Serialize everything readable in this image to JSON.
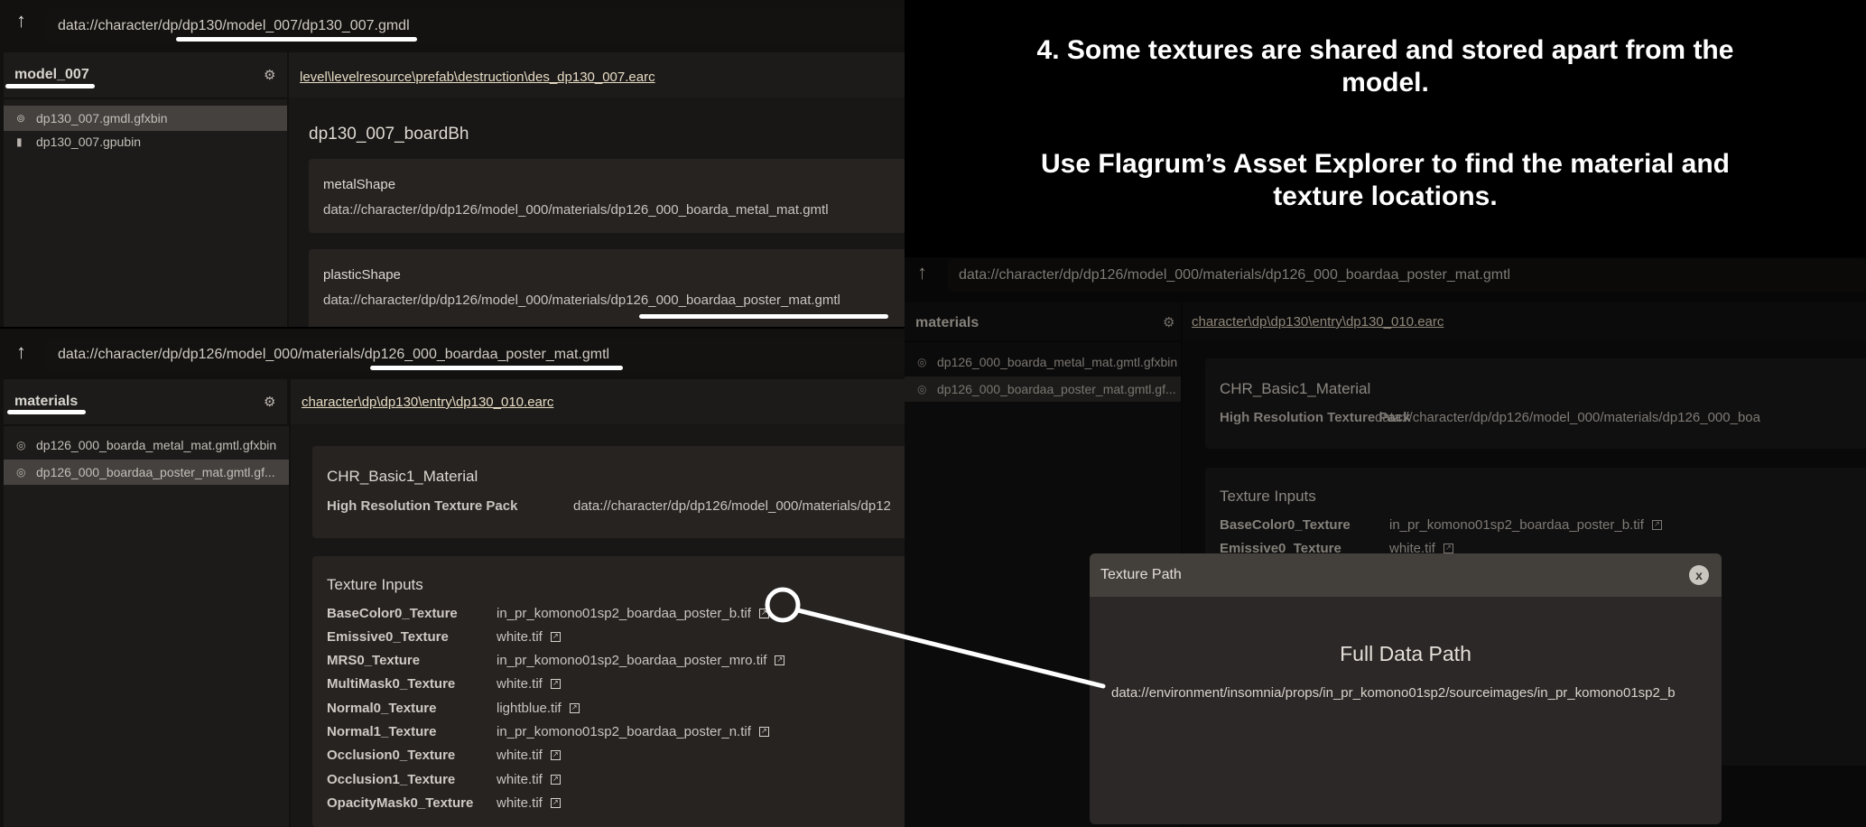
{
  "annotation": {
    "line1": "4. Some textures are shared and stored apart from the",
    "line2": "model.",
    "line3": "Use Flagrum’s Asset Explorer to find the material and",
    "line4": "texture locations."
  },
  "top_panel": {
    "address": "data://character/dp/dp130/model_007/dp130_007.gmdl",
    "folder": "model_007",
    "breadcrumb": "level\\levelresource\\prefab\\destruction\\des_dp130_007.earc",
    "files": [
      {
        "name": "dp130_007.gmdl.gfxbin",
        "icon": "model-icon",
        "selected": true
      },
      {
        "name": "dp130_007.gpubin",
        "icon": "file-icon",
        "selected": false
      }
    ],
    "title": "dp130_007_boardBh",
    "shapes": [
      {
        "name": "metalShape",
        "path": "data://character/dp/dp126/model_000/materials/dp126_000_boarda_metal_mat.gmtl"
      },
      {
        "name": "plasticShape",
        "path": "data://character/dp/dp126/model_000/materials/dp126_000_boardaa_poster_mat.gmtl"
      }
    ]
  },
  "bottom_panel": {
    "address": "data://character/dp/dp126/model_000/materials/dp126_000_boardaa_poster_mat.gmtl",
    "folder": "materials",
    "breadcrumb": "character\\dp\\dp130\\entry\\dp130_010.earc",
    "files": [
      {
        "name": "dp126_000_boarda_metal_mat.gmtl.gfxbin",
        "icon": "material-icon",
        "selected": false
      },
      {
        "name": "dp126_000_boardaa_poster_mat.gmtl.gf...",
        "icon": "material-icon",
        "selected": true
      }
    ],
    "material_name": "CHR_Basic1_Material",
    "hrtp_label": "High Resolution Texture Pack",
    "hrtp_value": "data://character/dp/dp126/model_000/materials/dp12",
    "texture_inputs_title": "Texture Inputs",
    "textures": [
      {
        "key": "BaseColor0_Texture",
        "value": "in_pr_komono01sp2_boardaa_poster_b.tif"
      },
      {
        "key": "Emissive0_Texture",
        "value": "white.tif"
      },
      {
        "key": "MRS0_Texture",
        "value": "in_pr_komono01sp2_boardaa_poster_mro.tif"
      },
      {
        "key": "MultiMask0_Texture",
        "value": "white.tif"
      },
      {
        "key": "Normal0_Texture",
        "value": "lightblue.tif"
      },
      {
        "key": "Normal1_Texture",
        "value": "in_pr_komono01sp2_boardaa_poster_n.tif"
      },
      {
        "key": "Occlusion0_Texture",
        "value": "white.tif"
      },
      {
        "key": "Occlusion1_Texture",
        "value": "white.tif"
      },
      {
        "key": "OpacityMask0_Texture",
        "value": "white.tif"
      }
    ]
  },
  "right_panel": {
    "address": "data://character/dp/dp126/model_000/materials/dp126_000_boardaa_poster_mat.gmtl",
    "folder": "materials",
    "breadcrumb": "character\\dp\\dp130\\entry\\dp130_010.earc",
    "files": [
      {
        "name": "dp126_000_boarda_metal_mat.gmtl.gfxbin",
        "selected": false
      },
      {
        "name": "dp126_000_boardaa_poster_mat.gmtl.gf...",
        "selected": true
      }
    ],
    "material_name": "CHR_Basic1_Material",
    "hrtp_label": "High Resolution Texture Pack",
    "hrtp_value": "data://character/dp/dp126/model_000/materials/dp126_000_boa",
    "texture_inputs_title": "Texture Inputs",
    "textures": [
      {
        "key": "BaseColor0_Texture",
        "value": "in_pr_komono01sp2_boardaa_poster_b.tif"
      },
      {
        "key": "Emissive0_Texture",
        "value": "white.tif"
      }
    ]
  },
  "modal": {
    "title": "Texture Path",
    "close_label": "x",
    "heading": "Full Data Path",
    "path": "data://environment/insomnia/props/in_pr_komono01sp2/sourceimages/in_pr_komono01sp2_b"
  }
}
